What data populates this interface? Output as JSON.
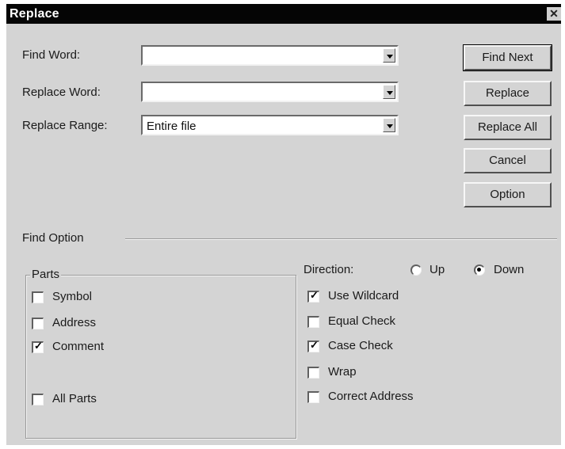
{
  "window": {
    "title": "Replace",
    "close_glyph": "✕"
  },
  "fields": {
    "find_word_label": "Find Word:",
    "find_word_value": "",
    "replace_word_label": "Replace Word:",
    "replace_word_value": "",
    "replace_range_label": "Replace Range:",
    "replace_range_value": "Entire file"
  },
  "buttons": {
    "find_next": "Find Next",
    "replace": "Replace",
    "replace_all": "Replace All",
    "cancel": "Cancel",
    "option": "Option"
  },
  "find_option": {
    "label": "Find Option",
    "parts": {
      "label": "Parts",
      "items": [
        {
          "label": "Symbol",
          "checked": false
        },
        {
          "label": "Address",
          "checked": false
        },
        {
          "label": "Comment",
          "checked": true
        },
        {
          "label": "All Parts",
          "checked": false
        }
      ]
    },
    "direction": {
      "label": "Direction:",
      "up_label": "Up",
      "down_label": "Down",
      "selected": "Down"
    },
    "options": [
      {
        "label": "Use Wildcard",
        "checked": true
      },
      {
        "label": "Equal Check",
        "checked": false
      },
      {
        "label": "Case Check",
        "checked": true
      },
      {
        "label": "Wrap",
        "checked": false
      },
      {
        "label": "Correct Address",
        "checked": false
      }
    ]
  },
  "check_glyph": "✓"
}
